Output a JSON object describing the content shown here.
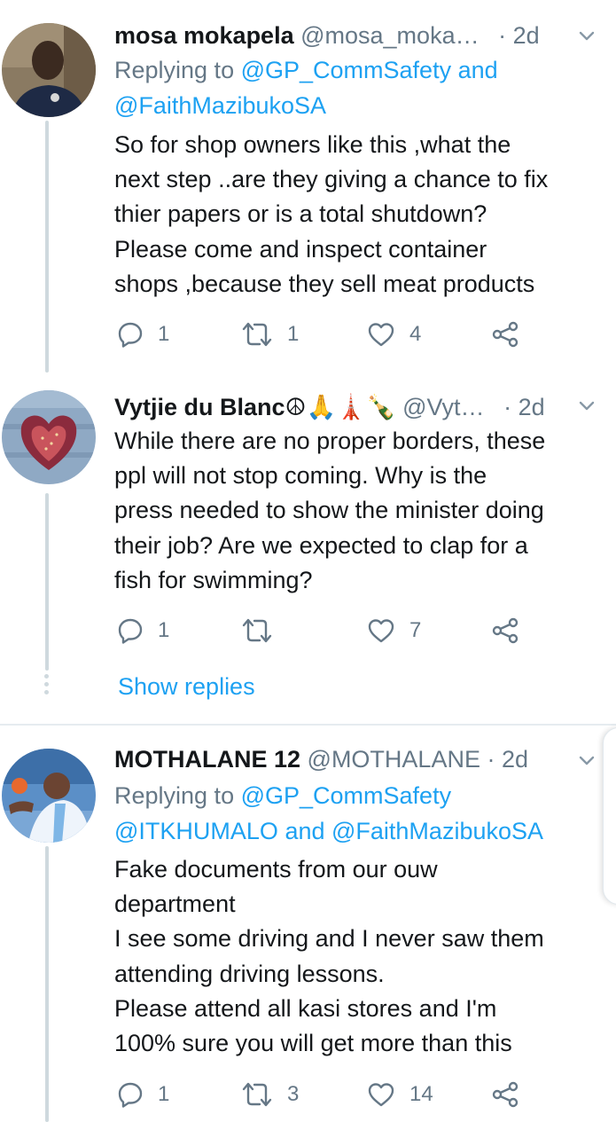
{
  "tweets": [
    {
      "name": "mosa mokapela",
      "handle": "@mosa_moka…",
      "dot": "·",
      "time": "2d",
      "replying_prefix": "Replying to ",
      "replying_to_1": "@GP_CommSafety",
      "replying_and": " and",
      "replying_to_2": "@FaithMazibukoSA",
      "text_lines": [
        "So for shop owners like this ,what the",
        "next step ..are they giving a chance to fix",
        "thier papers or is a total shutdown?",
        "Please come and inspect container",
        "shops ,because they sell meat products"
      ],
      "reply_count": "1",
      "retweet_count": "1",
      "like_count": "4"
    },
    {
      "name": "Vytjie du Blanc☮🙏🗼🍾",
      "handle": "@Vyt…",
      "dot": "·",
      "time": "2d",
      "text_lines": [
        "While there are no proper borders, these",
        "ppl will not stop coming. Why is the",
        "press needed to show the minister doing",
        "their job? Are we expected to clap for a",
        "fish for swimming?"
      ],
      "reply_count": "1",
      "retweet_count": "",
      "like_count": "7",
      "show_replies": "Show replies"
    },
    {
      "name": "MOTHALANE 12",
      "handle": "@MOTHALANE",
      "dot": "·",
      "time": "2d",
      "replying_prefix": "Replying to ",
      "replying_to_1": "@GP_CommSafety",
      "replying_to_2": "@ITKHUMALO",
      "replying_and": " and ",
      "replying_to_3": "@FaithMazibukoSA",
      "text_lines": [
        "Fake documents from our ouw",
        "department",
        "I see some driving and I never saw them",
        "attending driving lessons.",
        "Please attend all kasi stores and I'm",
        "100% sure you will get more than this"
      ],
      "reply_count": "1",
      "retweet_count": "3",
      "like_count": "14"
    }
  ],
  "icons": {
    "reply": "reply-icon",
    "retweet": "retweet-icon",
    "like": "heart-icon",
    "share": "share-icon",
    "caret": "chevron-down-icon"
  },
  "colors": {
    "link": "#1da1f2",
    "secondary": "#657786",
    "text": "#14171a",
    "thread_line": "#cfd9de"
  }
}
